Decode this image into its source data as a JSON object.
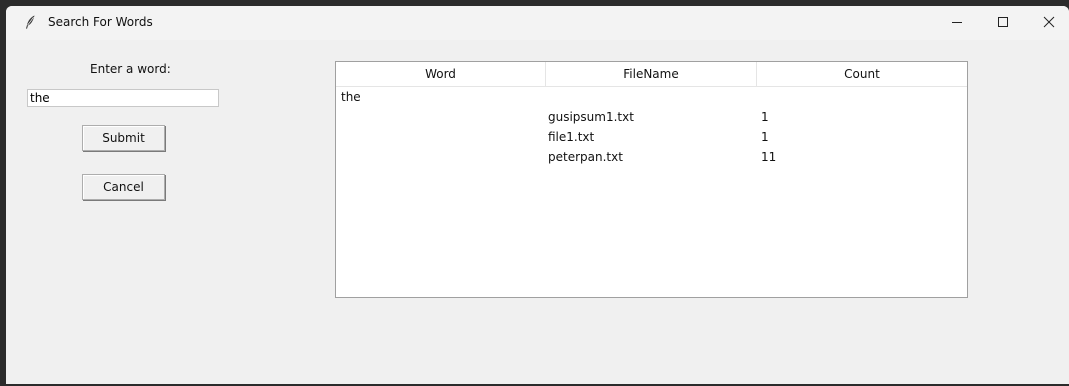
{
  "window": {
    "title": "Search For Words",
    "icon": "feather-icon"
  },
  "form": {
    "prompt_label": "Enter a word:",
    "input_value": "the",
    "submit_label": "Submit",
    "cancel_label": "Cancel"
  },
  "results": {
    "columns": [
      "Word",
      "FileName",
      "Count"
    ],
    "rows": [
      {
        "word": "the",
        "file": "",
        "count": ""
      },
      {
        "word": "",
        "file": "gusipsum1.txt",
        "count": "1"
      },
      {
        "word": "",
        "file": "file1.txt",
        "count": "1"
      },
      {
        "word": "",
        "file": "peterpan.txt",
        "count": "11"
      }
    ]
  }
}
